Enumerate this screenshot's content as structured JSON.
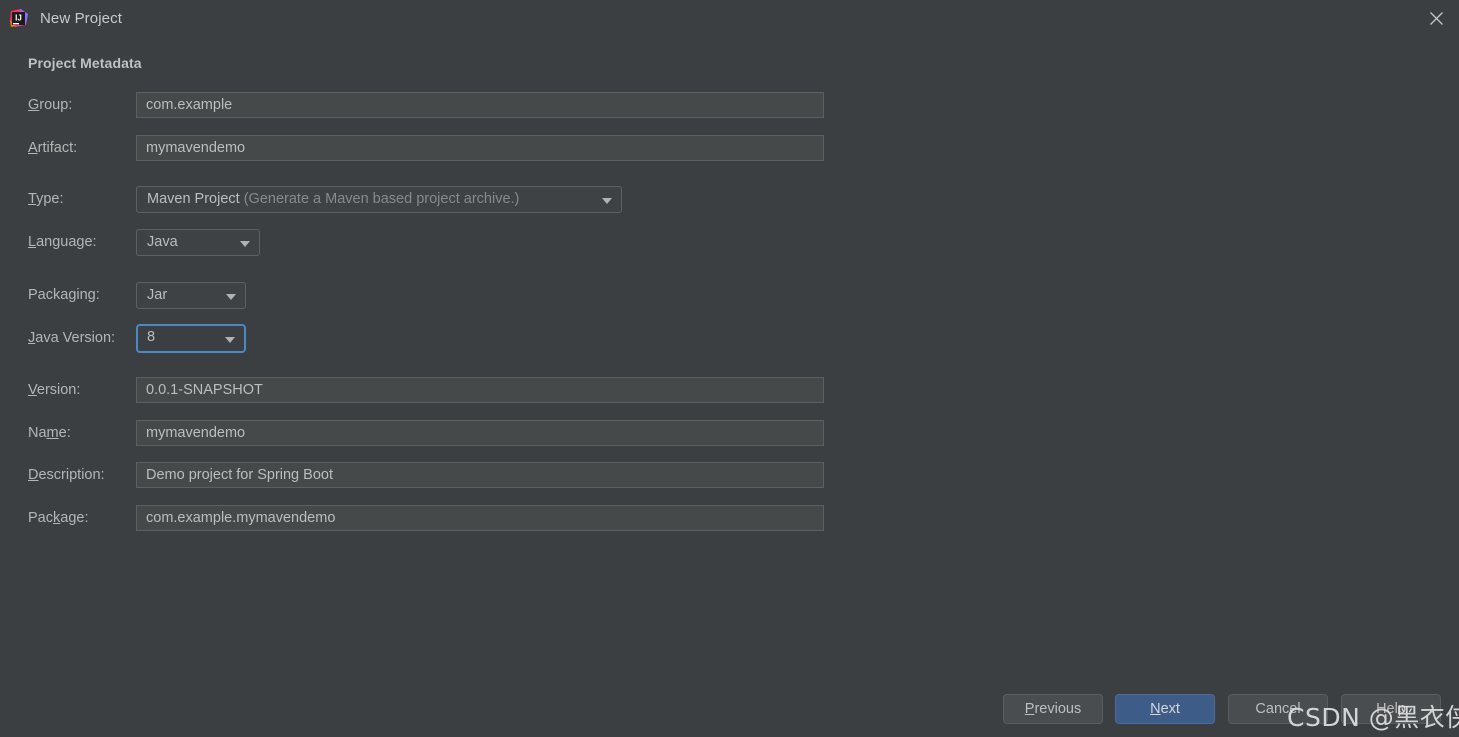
{
  "window": {
    "title": "New Project",
    "icon": "intellij-idea-logo-icon",
    "close_icon": "close-icon",
    "background_color": "#3c3f41"
  },
  "section": {
    "title": "Project Metadata"
  },
  "form": {
    "fields": [
      {
        "label": "Group:",
        "mnemonic": "G",
        "type": "text",
        "value": "com.example"
      },
      {
        "label": "Artifact:",
        "mnemonic": "A",
        "type": "text",
        "value": "mymavendemo"
      },
      {
        "label": "Type:",
        "mnemonic": "T",
        "type": "combo",
        "value": "Maven Project",
        "hint": "(Generate a Maven based project archive.)"
      },
      {
        "label": "Language:",
        "mnemonic": "L",
        "type": "combo",
        "value": "Java"
      },
      {
        "label": "Packaging:",
        "mnemonic": "g",
        "type": "combo",
        "value": "Jar"
      },
      {
        "label": "Java Version:",
        "mnemonic": "J",
        "type": "combo",
        "value": "8",
        "focused": true
      },
      {
        "label": "Version:",
        "mnemonic": "V",
        "type": "text",
        "value": "0.0.1-SNAPSHOT"
      },
      {
        "label": "Name:",
        "mnemonic": "m",
        "type": "text",
        "value": "mymavendemo"
      },
      {
        "label": "Description:",
        "mnemonic": "D",
        "type": "text",
        "value": "Demo project for Spring Boot"
      },
      {
        "label": "Package:",
        "mnemonic": "k",
        "type": "text",
        "value": "com.example.mymavendemo"
      }
    ]
  },
  "footer": {
    "buttons": [
      {
        "name": "previous",
        "label": "Previous",
        "mnemonic": "P",
        "primary": false
      },
      {
        "name": "next",
        "label": "Next",
        "mnemonic": "N",
        "primary": true
      },
      {
        "name": "cancel",
        "label": "Cancel",
        "mnemonic": "",
        "primary": false
      },
      {
        "name": "help",
        "label": "Help",
        "mnemonic": "",
        "primary": false
      }
    ]
  },
  "watermark": {
    "text": "CSDN @黑衣侠客"
  },
  "colors": {
    "accent_blue": "#4a88c7",
    "primary_button": "#3d5c87",
    "field_background": "#45494a",
    "window_background": "#3c3f41"
  }
}
